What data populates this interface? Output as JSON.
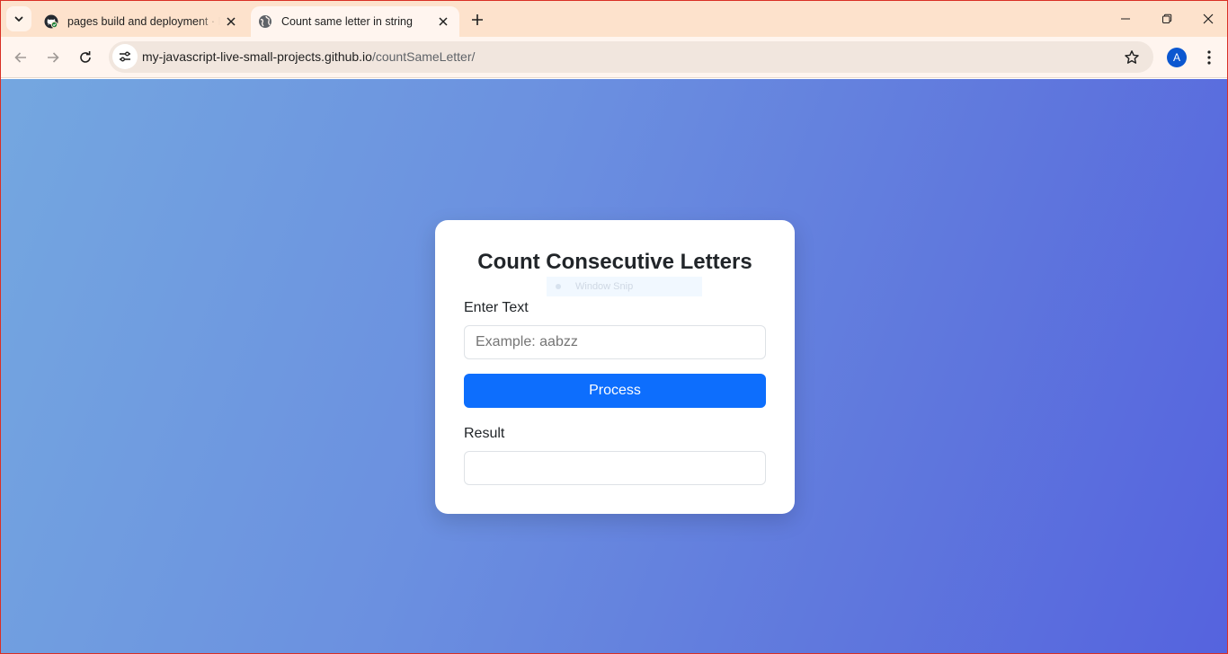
{
  "browser": {
    "tabs": [
      {
        "title": "pages build and deployment · My-JavaScript-live-small-projects",
        "active": false,
        "favicon": "github-icon"
      },
      {
        "title": "Count same letter in string",
        "active": true,
        "favicon": "globe-icon"
      }
    ],
    "address_bar": {
      "host": "my-javascript-live-small-projects.github.io",
      "path": "/countSameLetter/"
    },
    "profile_initial": "A"
  },
  "page": {
    "heading": "Count Consecutive Letters",
    "overlay_text": "Window Snip",
    "input_label": "Enter Text",
    "input_placeholder": "Example: aabzz",
    "input_value": "",
    "process_button": "Process",
    "result_label": "Result",
    "result_value": ""
  },
  "colors": {
    "tabstrip": "#fde2cc",
    "primary_button": "#0d6efd",
    "gradient_start": "#74a7e0",
    "gradient_end": "#5563de"
  }
}
